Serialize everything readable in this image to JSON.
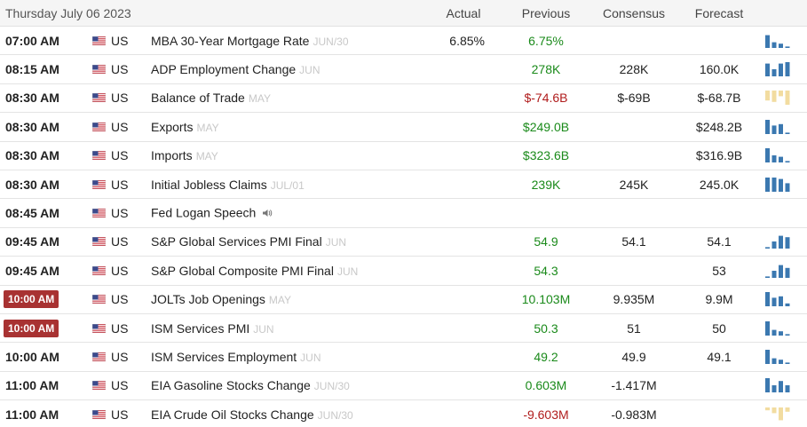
{
  "header": {
    "date": "Thursday July 06 2023",
    "col_actual": "Actual",
    "col_previous": "Previous",
    "col_consensus": "Consensus",
    "col_forecast": "Forecast"
  },
  "colors": {
    "positive": "#1a8a1a",
    "negative": "#b01c1c",
    "highlight_time": "#a83232",
    "spark_blue": "#3b78b0",
    "spark_tan": "#f2dca0"
  },
  "rows": [
    {
      "time": "07:00 AM",
      "highlight": false,
      "country": "US",
      "event": "MBA 30-Year Mortgage Rate",
      "ref": "JUN/30",
      "actual": "6.85%",
      "previous": "6.75%",
      "prev_dir": "pos",
      "consensus": "",
      "forecast": "",
      "speaker": false,
      "spark_color": "blue",
      "spark": [
        0.9,
        0.4,
        0.3,
        0.1
      ]
    },
    {
      "time": "08:15 AM",
      "highlight": false,
      "country": "US",
      "event": "ADP Employment Change",
      "ref": "JUN",
      "actual": "",
      "previous": "278K",
      "prev_dir": "pos",
      "consensus": "228K",
      "forecast": "160.0K",
      "speaker": false,
      "spark_color": "blue",
      "spark": [
        0.9,
        0.5,
        0.9,
        1.0
      ]
    },
    {
      "time": "08:30 AM",
      "highlight": false,
      "country": "US",
      "event": "Balance of Trade",
      "ref": "MAY",
      "actual": "",
      "previous": "$-74.6B",
      "prev_dir": "neg",
      "consensus": "$-69B",
      "forecast": "$-68.7B",
      "speaker": false,
      "spark_color": "tan",
      "spark": [
        0.7,
        0.8,
        0.4,
        1.0
      ]
    },
    {
      "time": "08:30 AM",
      "highlight": false,
      "country": "US",
      "event": "Exports",
      "ref": "MAY",
      "actual": "",
      "previous": "$249.0B",
      "prev_dir": "pos",
      "consensus": "",
      "forecast": "$248.2B",
      "speaker": false,
      "spark_color": "blue",
      "spark": [
        1.0,
        0.6,
        0.7,
        0.1
      ]
    },
    {
      "time": "08:30 AM",
      "highlight": false,
      "country": "US",
      "event": "Imports",
      "ref": "MAY",
      "actual": "",
      "previous": "$323.6B",
      "prev_dir": "pos",
      "consensus": "",
      "forecast": "$316.9B",
      "speaker": false,
      "spark_color": "blue",
      "spark": [
        1.0,
        0.5,
        0.4,
        0.1
      ]
    },
    {
      "time": "08:30 AM",
      "highlight": false,
      "country": "US",
      "event": "Initial Jobless Claims",
      "ref": "JUL/01",
      "actual": "",
      "previous": "239K",
      "prev_dir": "pos",
      "consensus": "245K",
      "forecast": "245.0K",
      "speaker": false,
      "spark_color": "blue",
      "spark": [
        1.0,
        1.0,
        0.9,
        0.6
      ]
    },
    {
      "time": "08:45 AM",
      "highlight": false,
      "country": "US",
      "event": "Fed Logan Speech",
      "ref": "",
      "actual": "",
      "previous": "",
      "prev_dir": "pos",
      "consensus": "",
      "forecast": "",
      "speaker": true,
      "spark_color": "none",
      "spark": []
    },
    {
      "time": "09:45 AM",
      "highlight": false,
      "country": "US",
      "event": "S&P Global Services PMI Final",
      "ref": "JUN",
      "actual": "",
      "previous": "54.9",
      "prev_dir": "pos",
      "consensus": "54.1",
      "forecast": "54.1",
      "speaker": false,
      "spark_color": "blue",
      "spark": [
        0.1,
        0.5,
        0.9,
        0.8
      ]
    },
    {
      "time": "09:45 AM",
      "highlight": false,
      "country": "US",
      "event": "S&P Global Composite PMI Final",
      "ref": "JUN",
      "actual": "",
      "previous": "54.3",
      "prev_dir": "pos",
      "consensus": "",
      "forecast": "53",
      "speaker": false,
      "spark_color": "blue",
      "spark": [
        0.1,
        0.5,
        0.9,
        0.7
      ]
    },
    {
      "time": "10:00 AM",
      "highlight": true,
      "country": "US",
      "event": "JOLTs Job Openings",
      "ref": "MAY",
      "actual": "",
      "previous": "10.103M",
      "prev_dir": "pos",
      "consensus": "9.935M",
      "forecast": "9.9M",
      "speaker": false,
      "spark_color": "blue",
      "spark": [
        1.0,
        0.6,
        0.7,
        0.2
      ]
    },
    {
      "time": "10:00 AM",
      "highlight": true,
      "country": "US",
      "event": "ISM Services PMI",
      "ref": "JUN",
      "actual": "",
      "previous": "50.3",
      "prev_dir": "pos",
      "consensus": "51",
      "forecast": "50",
      "speaker": false,
      "spark_color": "blue",
      "spark": [
        1.0,
        0.4,
        0.3,
        0.1
      ]
    },
    {
      "time": "10:00 AM",
      "highlight": false,
      "country": "US",
      "event": "ISM Services Employment",
      "ref": "JUN",
      "actual": "",
      "previous": "49.2",
      "prev_dir": "pos",
      "consensus": "49.9",
      "forecast": "49.1",
      "speaker": false,
      "spark_color": "blue",
      "spark": [
        1.0,
        0.4,
        0.3,
        0.1
      ]
    },
    {
      "time": "11:00 AM",
      "highlight": false,
      "country": "US",
      "event": "EIA Gasoline Stocks Change",
      "ref": "JUN/30",
      "actual": "",
      "previous": "0.603M",
      "prev_dir": "pos",
      "consensus": "-1.417M",
      "forecast": "",
      "speaker": false,
      "spark_color": "blue",
      "spark": [
        1.0,
        0.5,
        0.8,
        0.5
      ]
    },
    {
      "time": "11:00 AM",
      "highlight": false,
      "country": "US",
      "event": "EIA Crude Oil Stocks Change",
      "ref": "JUN/30",
      "actual": "",
      "previous": "-9.603M",
      "prev_dir": "neg",
      "consensus": "-0.983M",
      "forecast": "",
      "speaker": false,
      "spark_color": "tan",
      "spark": [
        0.2,
        0.4,
        0.9,
        0.3
      ]
    }
  ]
}
